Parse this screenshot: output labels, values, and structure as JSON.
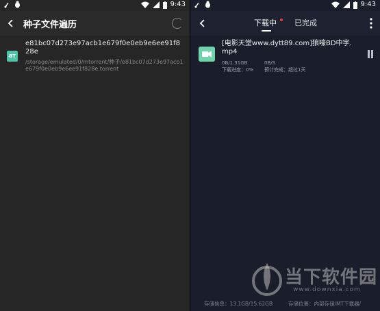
{
  "status_bar": {
    "time": "9:43",
    "icons": [
      "notification-icon",
      "bug-icon",
      "wifi-icon",
      "signal-icon",
      "battery-icon"
    ]
  },
  "left_screen": {
    "title": "种子文件遍历",
    "icons": [
      "back-arrow-icon",
      "loading-spinner-icon",
      "torrent-bt-icon"
    ],
    "torrent_badge": "BT",
    "file": {
      "name": "e81bc07d273e97acb1e679f0e0eb9e6ee91f828e",
      "path": "/storage/emulated/0/mtorrent/种子/e81bc07d273e97acb1e679f0e0eb9e6ee91f828e.torrent"
    }
  },
  "right_screen": {
    "tabs": [
      "下载中",
      "已完成"
    ],
    "active_tab": "下载中",
    "icons": [
      "back-arrow-icon",
      "more-vert-icon",
      "video-file-icon",
      "pause-icon"
    ],
    "colors": {
      "accent_dot": "#e53935",
      "video_icon": "#6fd4a9",
      "background": "#1a1e2b"
    },
    "download": {
      "name": "[电影天堂www.dytt89.com]狼嚎BD中字.mp4",
      "size": "0B/1.31GB",
      "speed": "0B/S",
      "progress": "下载进度：0%",
      "eta": "预计完成：超过1天"
    },
    "footer": {
      "storage": "存储信息：13.1GB/15.62GB",
      "location": "存储位置：内部存储/MT下载器/"
    }
  },
  "watermark": {
    "text": "当下软件园",
    "url": "www.downxia.com"
  }
}
